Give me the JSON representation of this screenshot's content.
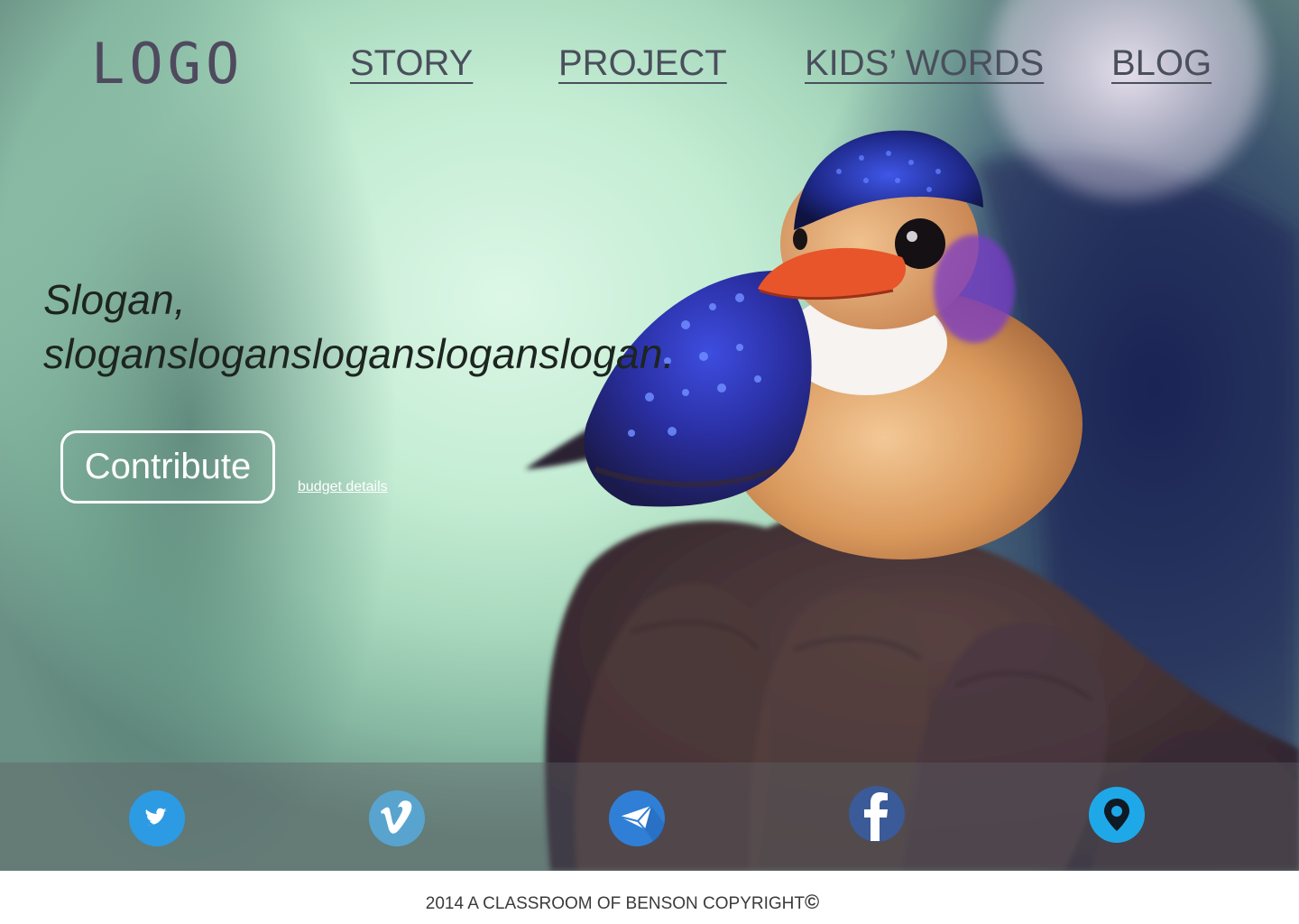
{
  "header": {
    "logo": "LOGO",
    "nav": [
      {
        "label": "STORY"
      },
      {
        "label": "PROJECT"
      },
      {
        "label": "KIDS’ WORDS"
      },
      {
        "label": "BLOG"
      }
    ]
  },
  "hero": {
    "slogan_line1": "Slogan,",
    "slogan_line2": "slogansloganslogansloganslogan.",
    "contribute_label": "Contribute",
    "budget_link": "budget details",
    "image": "kingfisher-on-hand-photo"
  },
  "social": [
    {
      "name": "twitter",
      "icon": "twitter-bird-icon",
      "color": "#2d9ae4"
    },
    {
      "name": "vimeo",
      "icon": "vimeo-v-icon",
      "color": "#58a4cf"
    },
    {
      "name": "mail",
      "icon": "envelope-icon",
      "color": "#2f7fd6"
    },
    {
      "name": "facebook",
      "icon": "facebook-f-icon",
      "color": "#3b5a98"
    },
    {
      "name": "location",
      "icon": "map-pin-icon",
      "color": "#1fa8e8"
    }
  ],
  "footer": {
    "copyright": "2014 A CLASSROOM OF BENSON COPYRIGHT",
    "copyright_symbol": "©"
  },
  "colors": {
    "nav_text": "#4a4f5c",
    "social_bar": "rgba(92,96,100,0.42)",
    "footer_bg": "#ffffff"
  }
}
